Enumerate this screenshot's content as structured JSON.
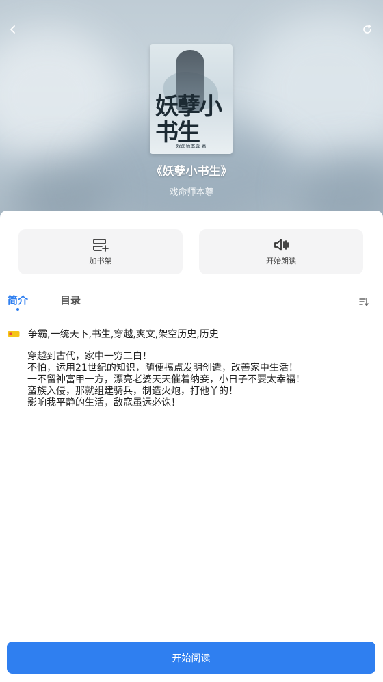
{
  "header": {
    "back_icon": "chevron-left-icon",
    "refresh_icon": "refresh-icon"
  },
  "book": {
    "title": "《妖孽小书生》",
    "author": "戏命师本尊",
    "cover": {
      "title": "妖孽小书生",
      "author_line": "戏命师本尊 著"
    }
  },
  "actions": {
    "add_shelf": {
      "label": "加书架",
      "icon": "bookshelf-add-icon"
    },
    "listen": {
      "label": "开始朗读",
      "icon": "speaker-icon"
    }
  },
  "tabs": [
    {
      "label": "简介"
    },
    {
      "label": "目录"
    }
  ],
  "sort_icon": "sort-icon",
  "tags": {
    "icon": "tag-icon",
    "text": "争霸,一统天下,书生,穿越,爽文,架空历史,历史"
  },
  "description": [
    "穿越到古代，家中一穷二白！",
    "不怕，运用21世纪的知识，随便搞点发明创造，改善家中生活！",
    "一不留神富甲一方，漂亮老婆天天催着纳妾，小日子不要太幸福！",
    "蛮族入侵，那就组建骑兵，制造火炮，打他丫的！",
    "影响我平静的生活，敌寇虽远必诛！"
  ],
  "read_button": {
    "label": "开始阅读"
  },
  "colors": {
    "accent": "#2f7ff0",
    "card_bg": "#f4f4f5"
  }
}
